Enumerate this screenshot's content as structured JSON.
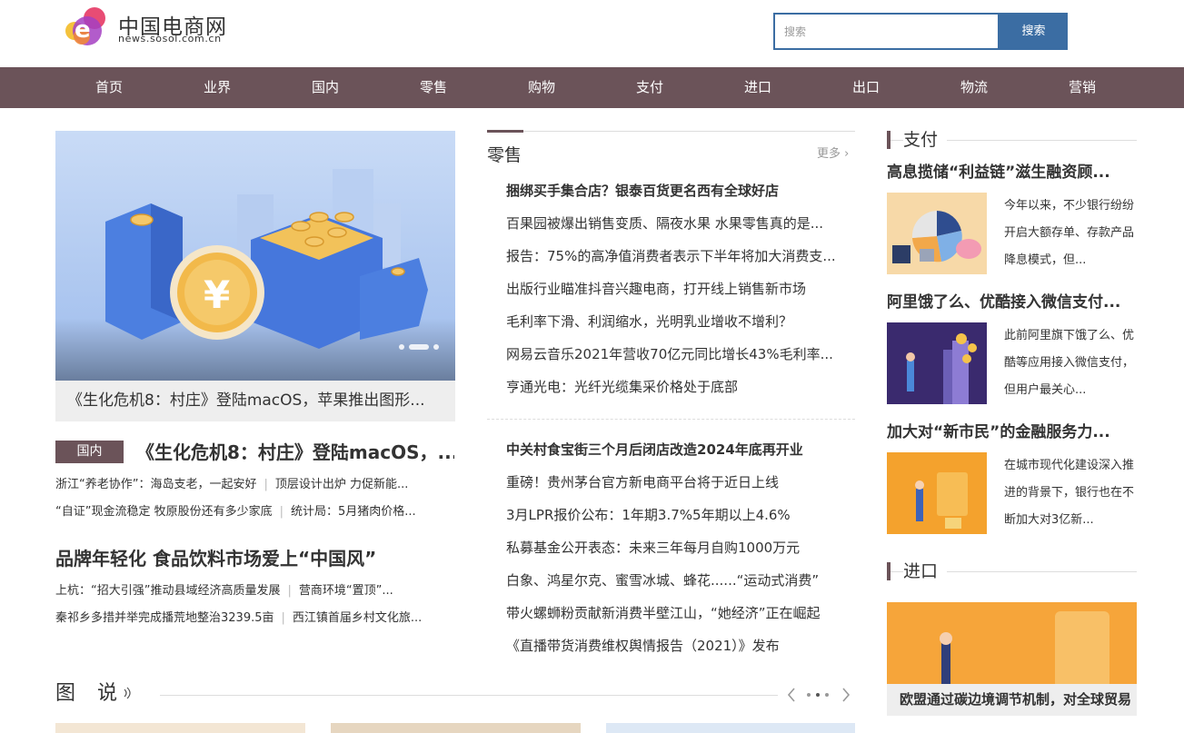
{
  "header": {
    "logo_title": "中国电商网",
    "logo_subtitle": "news.sosol.com.cn",
    "search_placeholder": "搜索",
    "search_button": "搜索"
  },
  "nav": [
    "首页",
    "业界",
    "国内",
    "零售",
    "购物",
    "支付",
    "进口",
    "出口",
    "物流",
    "营销"
  ],
  "carousel": {
    "caption": "《生化危机8：村庄》登陆macOS，苹果推出图形..."
  },
  "left_news": {
    "tag": "国内",
    "headline": "《生化危机8：村庄》登陆macOS，...",
    "sub_rows": [
      [
        "浙江“养老协作”：海岛支老，一起安好",
        "顶层设计出炉 力促新能..."
      ],
      [
        "“自证”现金流稳定 牧原股份还有多少家底",
        "统计局：5月猪肉价格..."
      ]
    ],
    "headline2": "品牌年轻化 食品饮料市场爱上“中国风”",
    "sub_rows2": [
      [
        "上杭：“招大引强”推动县域经济高质量发展",
        "营商环境“置顶”..."
      ],
      [
        "秦祁乡多措并举完成播荒地整治3239.5亩",
        "西江镇首届乡村文化旅..."
      ]
    ]
  },
  "middle": {
    "title": "零售",
    "more": "更多",
    "list1": [
      {
        "text": "捆绑买手集合店？银泰百货更名西有全球好店",
        "bold": true
      },
      {
        "text": "百果园被爆出销售变质、隔夜水果 水果零售真的是...",
        "bold": false
      },
      {
        "text": "报告：75%的高净值消费者表示下半年将加大消费支...",
        "bold": false
      },
      {
        "text": "出版行业瞄准抖音兴趣电商，打开线上销售新市场",
        "bold": false
      },
      {
        "text": "毛利率下滑、利润缩水，光明乳业增收不增利？",
        "bold": false
      },
      {
        "text": "网易云音乐2021年营收70亿元同比增长43%毛利率...",
        "bold": false
      },
      {
        "text": "亨通光电：光纤光缆集采价格处于底部",
        "bold": false
      }
    ],
    "list2": [
      {
        "text": "中关村食宝街三个月后闭店改造2024年底再开业",
        "bold": true
      },
      {
        "text": "重磅！贵州茅台官方新电商平台将于近日上线",
        "bold": false
      },
      {
        "text": "3月LPR报价公布：1年期3.7%5年期以上4.6%",
        "bold": false
      },
      {
        "text": "私募基金公开表态：未来三年每月自购1000万元",
        "bold": false
      },
      {
        "text": "白象、鸿星尔克、蜜雪冰城、蜂花......“运动式消费”",
        "bold": false
      },
      {
        "text": "带火螺蛳粉贡献新消费半壁江山，“她经济”正在崛起",
        "bold": false
      },
      {
        "text": "《直播带货消费维权舆情报告（2021）》发布",
        "bold": false
      }
    ]
  },
  "right": {
    "section1": "支付",
    "articles": [
      {
        "title": "高息揽储“利益链”滋生融资顾...",
        "desc": "今年以来，不少银行纷纷开启大额存单、存款产品降息模式，但..."
      },
      {
        "title": "阿里饿了么、优酷接入微信支付...",
        "desc": "此前阿里旗下饿了么、优酷等应用接入微信支付，但用户最关心..."
      },
      {
        "title": "加大对“新市民”的金融服务力...",
        "desc": "在城市现代化建设深入推进的背景下，银行也在不断加大对3亿新..."
      }
    ],
    "section2": "进口",
    "big_caption": "欧盟通过碳边境调节机制，对全球贸易"
  },
  "tushuo": {
    "title": "图说"
  }
}
